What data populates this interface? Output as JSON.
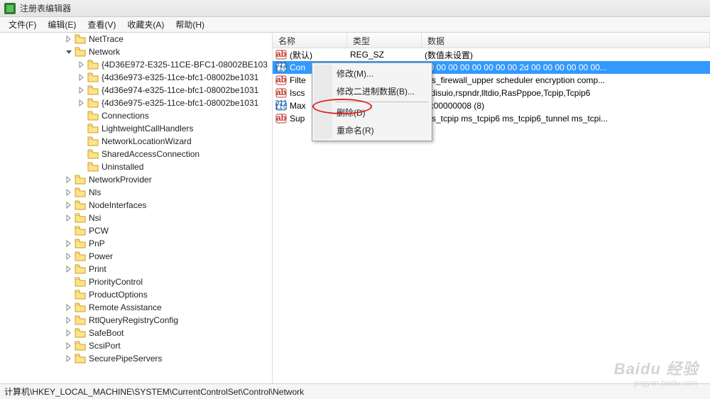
{
  "title": "注册表编辑器",
  "menu": {
    "file": "文件(F)",
    "edit": "编辑(E)",
    "view": "查看(V)",
    "favorites": "收藏夹(A)",
    "help": "帮助(H)"
  },
  "tree": [
    {
      "indent": 5,
      "expander": "closed",
      "label": "NetTrace"
    },
    {
      "indent": 5,
      "expander": "open",
      "label": "Network"
    },
    {
      "indent": 6,
      "expander": "closed",
      "label": "{4D36E972-E325-11CE-BFC1-08002BE103"
    },
    {
      "indent": 6,
      "expander": "closed",
      "label": "{4d36e973-e325-11ce-bfc1-08002be1031"
    },
    {
      "indent": 6,
      "expander": "closed",
      "label": "{4d36e974-e325-11ce-bfc1-08002be1031"
    },
    {
      "indent": 6,
      "expander": "closed",
      "label": "{4d36e975-e325-11ce-bfc1-08002be1031"
    },
    {
      "indent": 6,
      "expander": "none",
      "label": "Connections"
    },
    {
      "indent": 6,
      "expander": "none",
      "label": "LightweightCallHandlers"
    },
    {
      "indent": 6,
      "expander": "none",
      "label": "NetworkLocationWizard"
    },
    {
      "indent": 6,
      "expander": "none",
      "label": "SharedAccessConnection"
    },
    {
      "indent": 6,
      "expander": "none",
      "label": "Uninstalled"
    },
    {
      "indent": 5,
      "expander": "closed",
      "label": "NetworkProvider"
    },
    {
      "indent": 5,
      "expander": "closed",
      "label": "Nls"
    },
    {
      "indent": 5,
      "expander": "closed",
      "label": "NodeInterfaces"
    },
    {
      "indent": 5,
      "expander": "closed",
      "label": "Nsi"
    },
    {
      "indent": 5,
      "expander": "none",
      "label": "PCW"
    },
    {
      "indent": 5,
      "expander": "closed",
      "label": "PnP"
    },
    {
      "indent": 5,
      "expander": "closed",
      "label": "Power"
    },
    {
      "indent": 5,
      "expander": "closed",
      "label": "Print"
    },
    {
      "indent": 5,
      "expander": "none",
      "label": "PriorityControl"
    },
    {
      "indent": 5,
      "expander": "none",
      "label": "ProductOptions"
    },
    {
      "indent": 5,
      "expander": "closed",
      "label": "Remote Assistance"
    },
    {
      "indent": 5,
      "expander": "closed",
      "label": "RtlQueryRegistryConfig"
    },
    {
      "indent": 5,
      "expander": "closed",
      "label": "SafeBoot"
    },
    {
      "indent": 5,
      "expander": "closed",
      "label": "ScsiPort"
    },
    {
      "indent": 5,
      "expander": "closed",
      "label": "SecurePipeServers"
    }
  ],
  "list": {
    "headers": {
      "name": "名称",
      "type": "类型",
      "data": "数据"
    },
    "rows": [
      {
        "icon": "ab",
        "name": "(默认)",
        "type": "REG_SZ",
        "data": "(数值未设置)",
        "selected": false
      },
      {
        "icon": "bin",
        "name": "Con",
        "type": "",
        "data": "00 00 00 00 00 00 00 00 2d 00 00 00 00 00 00...",
        "selected": true
      },
      {
        "icon": "ab",
        "name": "Filte",
        "type": "",
        "data": "ms_firewall_upper scheduler encryption comp...",
        "selected": false
      },
      {
        "icon": "ab",
        "name": "Iscs",
        "type": "",
        "data": "Ndisuio,rspndr,lltdio,RasPppoe,Tcpip,Tcpip6",
        "selected": false
      },
      {
        "icon": "bin",
        "name": "Max",
        "type": "",
        "data": "0x00000008 (8)",
        "selected": false
      },
      {
        "icon": "ab",
        "name": "Sup",
        "type": "",
        "data": "ms_tcpip ms_tcpip6 ms_tcpip6_tunnel ms_tcpi...",
        "selected": false
      }
    ]
  },
  "context_menu": {
    "modify": "修改(M)...",
    "modify_binary": "修改二进制数据(B)...",
    "delete": "删除(D)",
    "rename": "重命名(R)"
  },
  "status": "计算机\\HKEY_LOCAL_MACHINE\\SYSTEM\\CurrentControlSet\\Control\\Network",
  "watermark": {
    "main": "Baidu 经验",
    "sub": "jingyan.baidu.com"
  }
}
